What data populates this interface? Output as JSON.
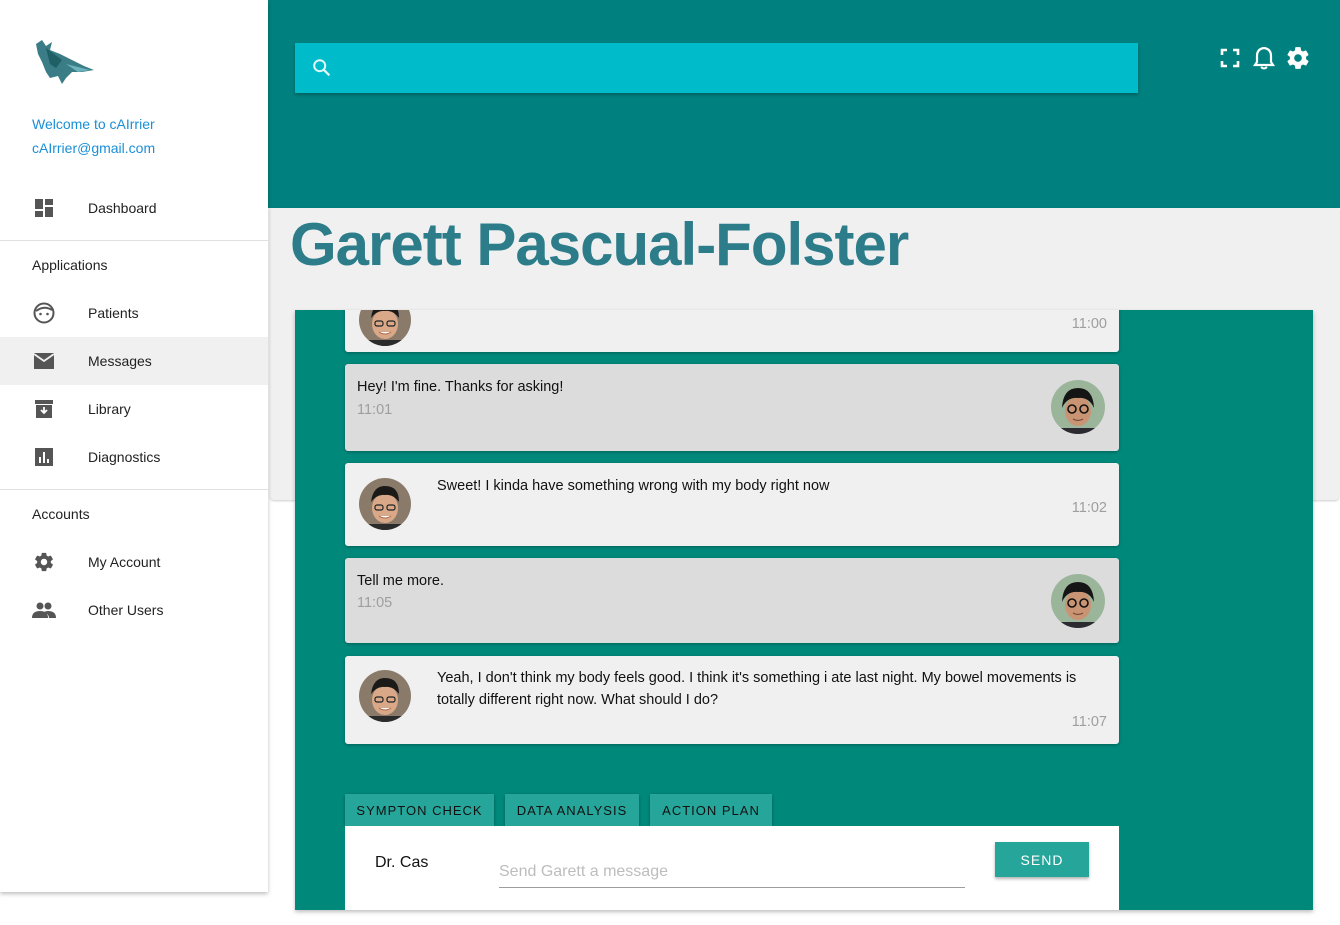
{
  "sidebar": {
    "welcome": "Welcome to cAIrrier",
    "email": "cAIrrier@gmail.com",
    "dashboard_label": "Dashboard",
    "applications_title": "Applications",
    "accounts_title": "Accounts",
    "items": [
      {
        "label": "Patients",
        "icon": "face-icon"
      },
      {
        "label": "Messages",
        "icon": "mail-icon",
        "active": true
      },
      {
        "label": "Library",
        "icon": "archive-icon"
      },
      {
        "label": "Diagnostics",
        "icon": "bar-chart-icon"
      }
    ],
    "account_items": [
      {
        "label": "My Account",
        "icon": "gear-icon"
      },
      {
        "label": "Other Users",
        "icon": "people-icon"
      }
    ]
  },
  "header": {
    "search_placeholder": "",
    "icons": [
      "fullscreen-icon",
      "bell-icon",
      "gear-icon"
    ],
    "color": "#00807f",
    "search_color": "#00bcca"
  },
  "patient": {
    "name": "Garett Pascual-Folster"
  },
  "messages": [
    {
      "from": "patient",
      "text": "",
      "time": "11:00"
    },
    {
      "from": "doctor",
      "text": "Hey! I'm fine. Thanks for asking!",
      "time": "11:01"
    },
    {
      "from": "patient",
      "text": "Sweet! I kinda have something wrong with my body right now",
      "time": "11:02"
    },
    {
      "from": "doctor",
      "text": "Tell me more.",
      "time": "11:05"
    },
    {
      "from": "patient",
      "text": "Yeah, I don't think my body feels good. I think it's something i ate last night. My bowel movements is totally different right now. What should I do?",
      "time": "11:07"
    }
  ],
  "actions": {
    "symptom": "SYMPTON CHECK",
    "data": "DATA ANALYSIS",
    "plan": "ACTION PLAN"
  },
  "composer": {
    "sender": "Dr. Cas",
    "placeholder": "Send Garett a message",
    "send_label": "SEND"
  },
  "colors": {
    "panel": "#00897b",
    "button": "#26a69a",
    "name": "#2c7c8a"
  }
}
